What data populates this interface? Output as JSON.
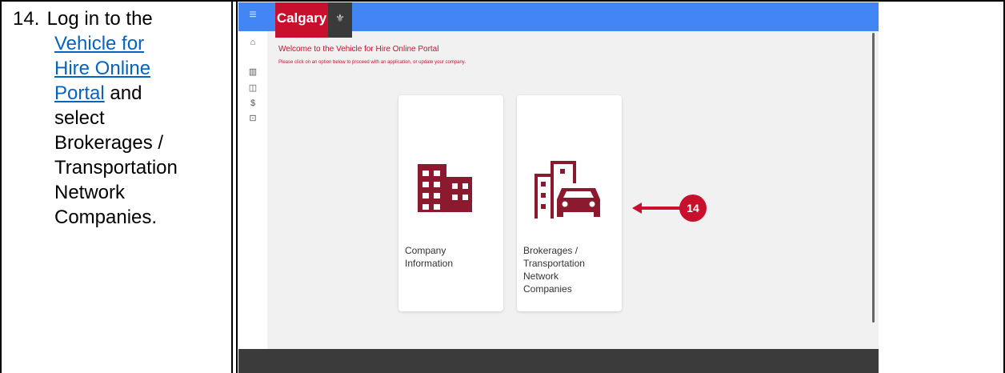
{
  "document": {
    "step_number": "14.",
    "step_lines": [
      "Log in to the"
    ],
    "link_text_lines": [
      "Vehicle for",
      "Hire Online",
      "Portal"
    ],
    "after_link": " and",
    "rest_lines": [
      "select",
      "Brokerages /",
      "Transportation",
      "Network",
      "Companies."
    ]
  },
  "portal": {
    "logo_text": "Calgary",
    "welcome_title": "Welcome to the Vehicle for Hire Online Portal",
    "instructions": "Please click on an option below to proceed with an application, or update your company.",
    "cards": [
      {
        "label_lines": [
          "Company",
          "Information"
        ],
        "icon": "building-icon"
      },
      {
        "label_lines": [
          "Brokerages /",
          "Transportation",
          "Network",
          "Companies"
        ],
        "icon": "city-car-icon"
      }
    ],
    "callout_number": "14",
    "sidebar_icons": [
      "home-icon",
      "building-icon",
      "taxi-icon",
      "dollar-icon",
      "lock-icon"
    ],
    "colors": {
      "brand_red": "#c8102e",
      "icon_maroon": "#8b1a2e",
      "topbar_blue": "#4285f4"
    }
  }
}
